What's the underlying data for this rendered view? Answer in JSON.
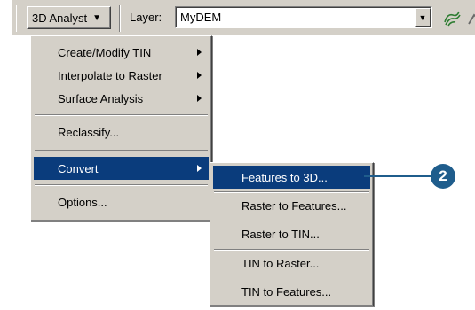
{
  "toolbar": {
    "analyst_button_label": "3D Analyst",
    "layer_label": "Layer:",
    "layer_value": "MyDEM",
    "icons": [
      "grip-handle",
      "3d-analyst-dropdown-arrow",
      "combo-dropdown-arrow",
      "contour-tool",
      "steepest-path-tool"
    ]
  },
  "menu": {
    "items": [
      {
        "label": "Create/Modify TIN",
        "submenu": true
      },
      {
        "label": "Interpolate to Raster",
        "submenu": true
      },
      {
        "label": "Surface Analysis",
        "submenu": true
      },
      {
        "label": "Reclassify...",
        "submenu": false
      },
      {
        "label": "Convert",
        "submenu": true,
        "selected": true
      },
      {
        "label": "Options...",
        "submenu": false
      }
    ]
  },
  "submenu": {
    "items": [
      {
        "label": "Features to 3D...",
        "selected": true
      },
      {
        "label": "Raster to Features..."
      },
      {
        "label": "Raster to TIN..."
      },
      {
        "label": "TIN to Raster..."
      },
      {
        "label": "TIN to Features..."
      }
    ]
  },
  "callout": {
    "number": "2"
  },
  "colors": {
    "menu_bg": "#d4d0c8",
    "highlight": "#0a3c7c",
    "callout": "#1f5d8c"
  }
}
